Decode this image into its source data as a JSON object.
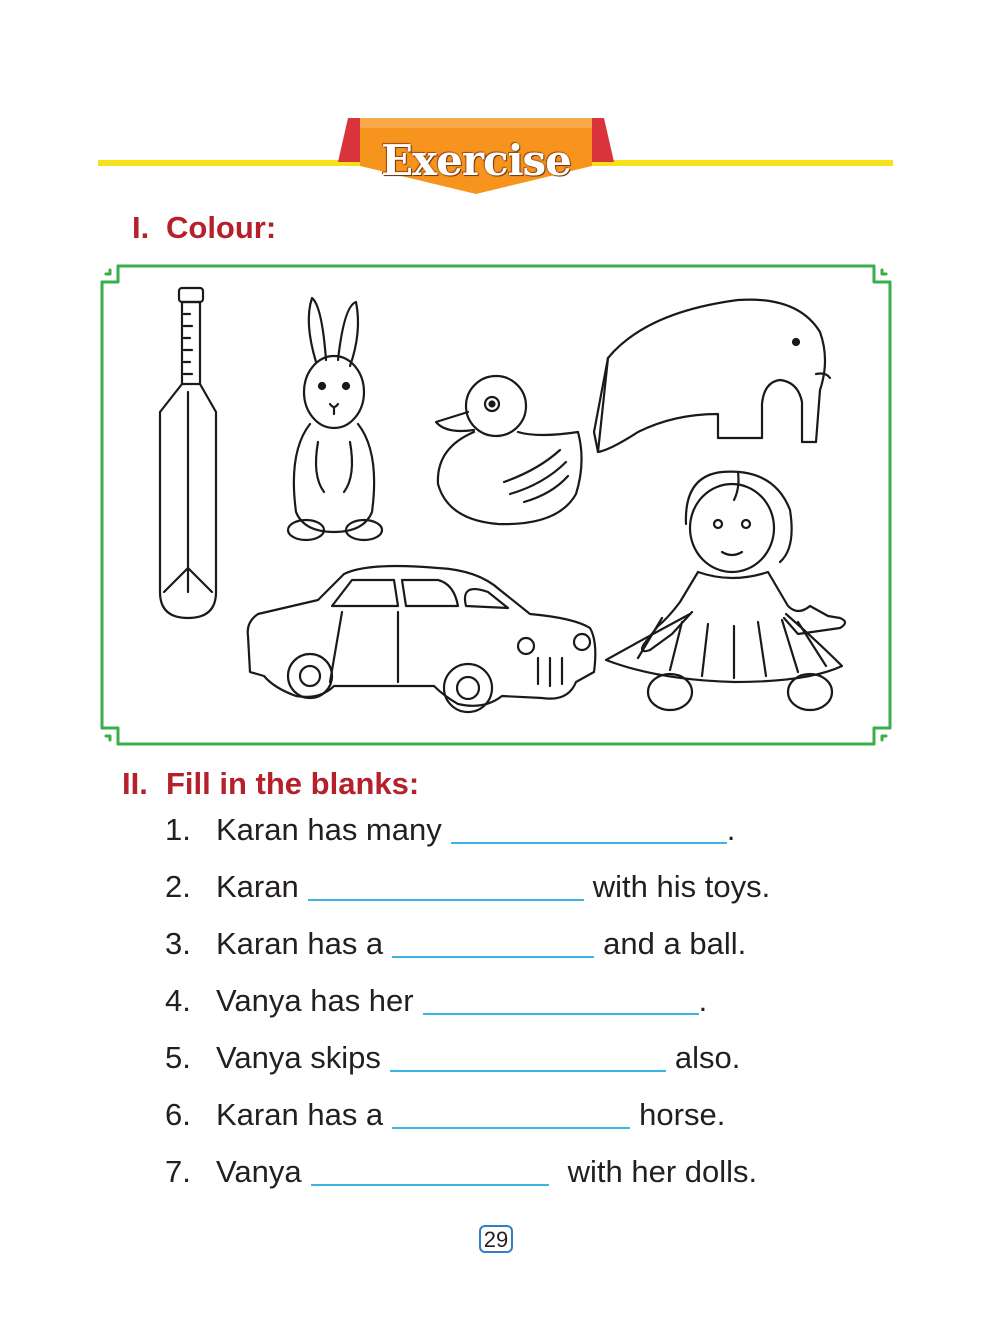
{
  "banner": {
    "title": "Exercise"
  },
  "sections": [
    {
      "number": "I.",
      "title": "Colour:"
    },
    {
      "number": "II.",
      "title": "Fill in the blanks:"
    }
  ],
  "colour_pictures": [
    "cricket-bat",
    "rabbit",
    "duck",
    "elephant",
    "doll",
    "car"
  ],
  "blanks": [
    {
      "n": "1.",
      "before": "Karan has many",
      "after": "."
    },
    {
      "n": "2.",
      "before": "Karan",
      "after": "with his toys."
    },
    {
      "n": "3.",
      "before": "Karan has a",
      "after": "and a ball."
    },
    {
      "n": "4.",
      "before": "Vanya has her",
      "after": "."
    },
    {
      "n": "5.",
      "before": "Vanya skips",
      "after": "also."
    },
    {
      "n": "6.",
      "before": "Karan has a",
      "after": "horse."
    },
    {
      "n": "7.",
      "before": "Vanya",
      "after": "with her dolls."
    }
  ],
  "page_number": "29",
  "colors": {
    "heading": "#b5202a",
    "blank_line": "#3db3e6",
    "frame": "#3aae49",
    "banner": "#f7941d",
    "rule": "#f5e11c"
  }
}
